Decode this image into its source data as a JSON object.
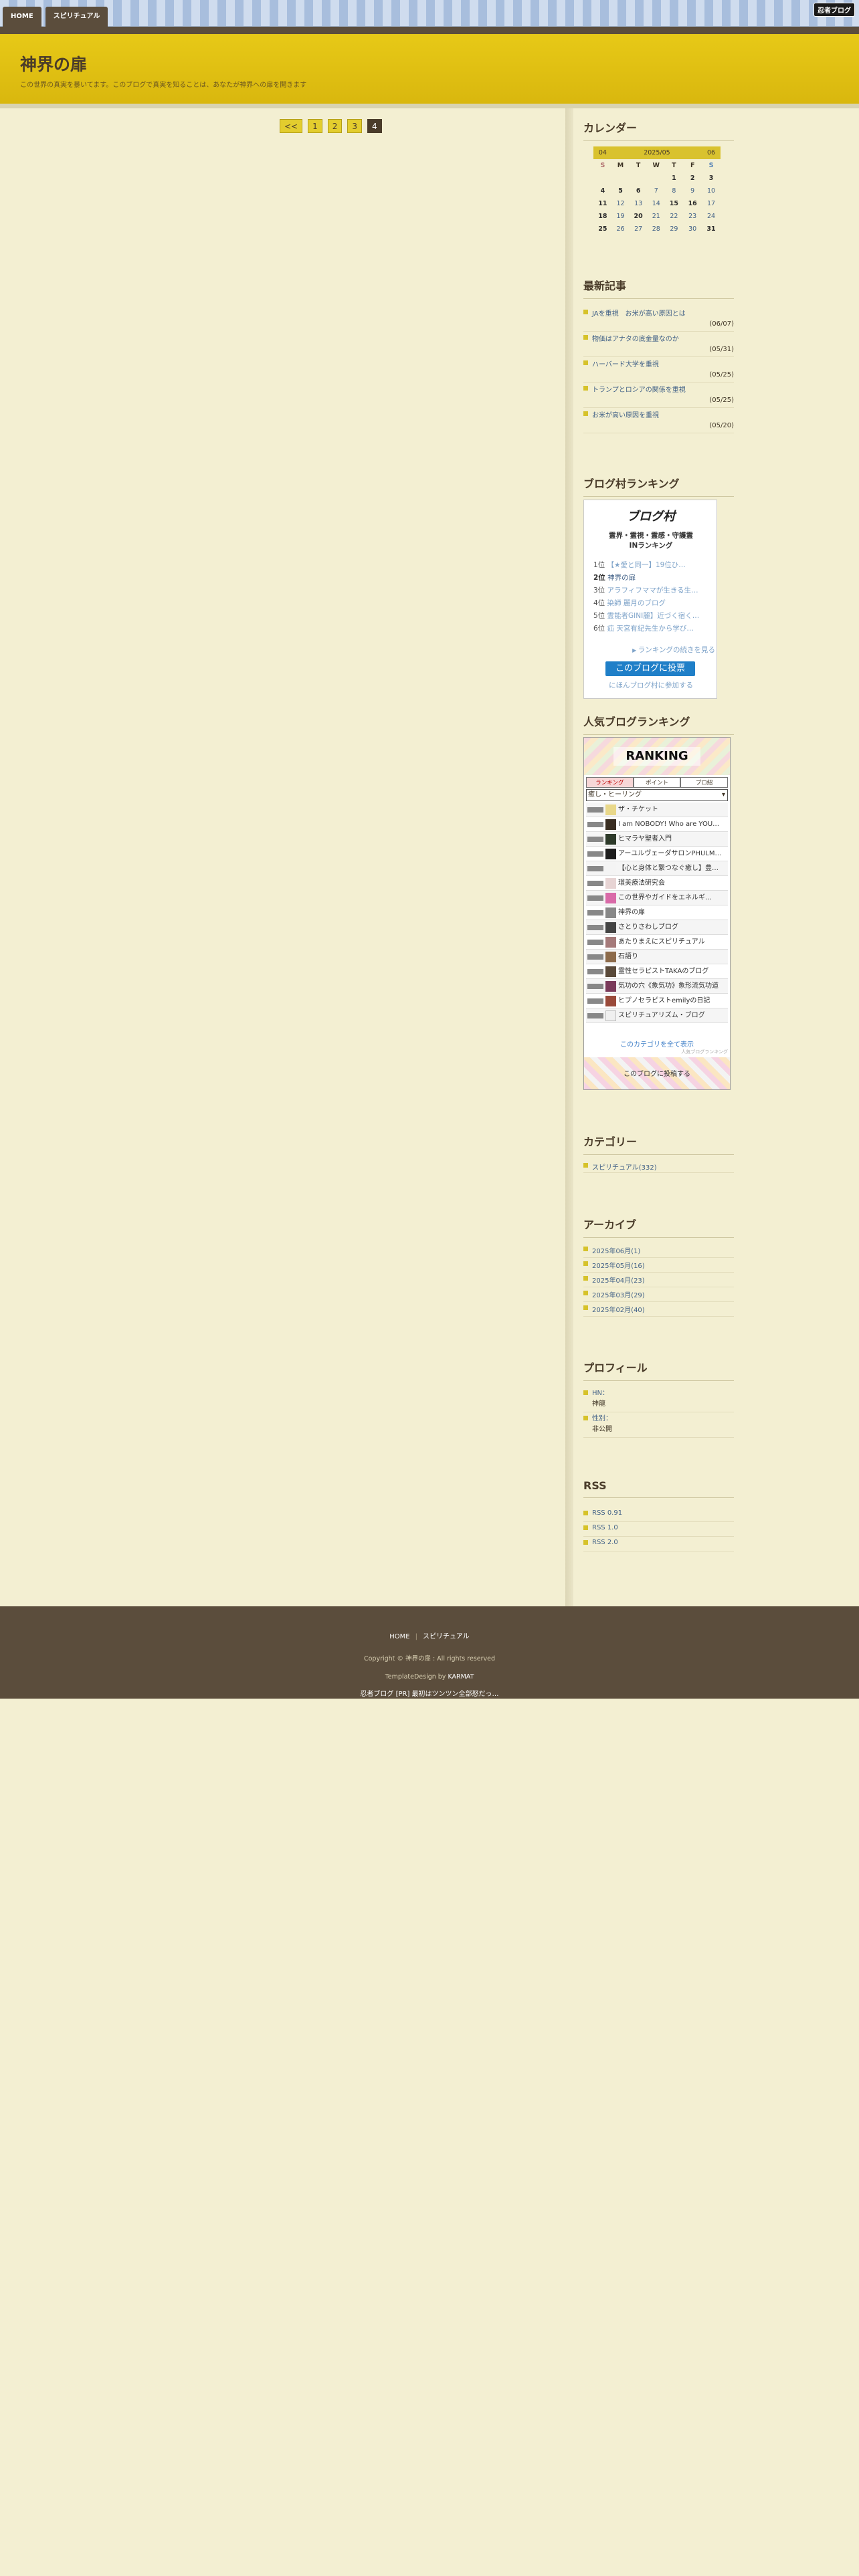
{
  "nav": {
    "items": [
      "HOME",
      "スピリチュアル"
    ],
    "badge": "忍者ブログ"
  },
  "header": {
    "title": "神界の扉",
    "description": "この世界の真実を暴いてます。このブログで真実を知ることは、あなたが神界への扉を開きます"
  },
  "pager": {
    "prev": "<<",
    "pages": [
      "1",
      "2",
      "3",
      "4"
    ],
    "current": "4"
  },
  "calendar": {
    "title": "カレンダー",
    "prev": "04",
    "month": "2025/05",
    "next": "06",
    "dow": [
      "S",
      "M",
      "T",
      "W",
      "T",
      "F",
      "S"
    ],
    "weeks": [
      [
        "",
        "",
        "",
        "",
        "1",
        "2",
        "3"
      ],
      [
        "4",
        "5",
        "6",
        "7",
        "8",
        "9",
        "10"
      ],
      [
        "11",
        "12",
        "13",
        "14",
        "15",
        "16",
        "17"
      ],
      [
        "18",
        "19",
        "20",
        "21",
        "22",
        "23",
        "24"
      ],
      [
        "25",
        "26",
        "27",
        "28",
        "29",
        "30",
        "31"
      ]
    ]
  },
  "recent": {
    "title": "最新記事",
    "items": [
      {
        "label": "JAを重視　お米が高い原因とは",
        "date": "(06/07)"
      },
      {
        "label": "物価はアナタの底金量なのか",
        "date": "(05/31)"
      },
      {
        "label": "ハーバード大学を重視",
        "date": "(05/25)"
      },
      {
        "label": "トランプとロシアの関係を重視",
        "date": "(05/25)"
      },
      {
        "label": "お米が高い原因を重視",
        "date": "(05/20)"
      }
    ]
  },
  "blogvillage": {
    "title": "ブログ村ランキング",
    "logo": "ブログ村",
    "sub1": "霊界・霊視・霊感・守護霊",
    "sub2": "INランキング",
    "ranks": [
      {
        "n": "1位",
        "t": "【★愛と同一】19位ひ…"
      },
      {
        "n": "2位",
        "t": "神界の扉"
      },
      {
        "n": "3位",
        "t": "アラフィフママが生きる生…"
      },
      {
        "n": "4位",
        "t": "染師 麗月のブログ"
      },
      {
        "n": "5位",
        "t": "霊能者GINI麗】近づく宿く…"
      },
      {
        "n": "6位",
        "t": "疝 天宮有紀先生から学び…"
      }
    ],
    "more": "ランキングの続きを見る",
    "vote": "このブログに投票",
    "join": "にほんブログ村に参加する"
  },
  "popular": {
    "title": "人気ブログランキング",
    "logo": "RANKING",
    "tabs": [
      "ランキング",
      "ポイント",
      "プロ紹"
    ],
    "select": "癒し・ヒーリング",
    "items": [
      "ザ・チケット",
      "I am NOBODY! Who are YOU…",
      "ヒマラヤ聖者入門",
      "アーユルヴェーダサロンPHULM…",
      "【心と身体と繋つなぐ癒し】豊…",
      "環美療法研究会",
      "この世界やガイドをエネルギ…",
      "神界の扉",
      "さとりさわしブログ",
      "あたりまえにスピリチュアル",
      "石語り",
      "霊性セラピストTAKAのブログ",
      "気功の穴《象気功》象形流気功道",
      "ヒプノセラピストemilyの日記",
      "スピリチュアリズム・ブログ"
    ],
    "all": "このカテゴリを全て表示",
    "jp": "人気ブログランキング",
    "join": "このブログに投稿する"
  },
  "category": {
    "title": "カテゴリー",
    "items": [
      "スピリチュアル(332)"
    ]
  },
  "archive": {
    "title": "アーカイブ",
    "items": [
      "2025年06月(1)",
      "2025年05月(16)",
      "2025年04月(23)",
      "2025年03月(29)",
      "2025年02月(40)"
    ]
  },
  "profile": {
    "title": "プロフィール",
    "hn_label": "HN：",
    "hn": "神龍",
    "sex_label": "性別：",
    "sex": "非公開"
  },
  "rss": {
    "title": "RSS",
    "items": [
      "RSS 0.91",
      "RSS 1.0",
      "RSS 2.0"
    ]
  },
  "footer": {
    "nav": [
      "HOME",
      "スピリチュアル"
    ],
    "copyright": "Copyright © 神界の扉 : All rights reserved",
    "template_prefix": "TemplateDesign by ",
    "template_author": "KARMAT",
    "ad": "忍者ブログ [PR] 最初はツンツン全部怒だっ…"
  }
}
